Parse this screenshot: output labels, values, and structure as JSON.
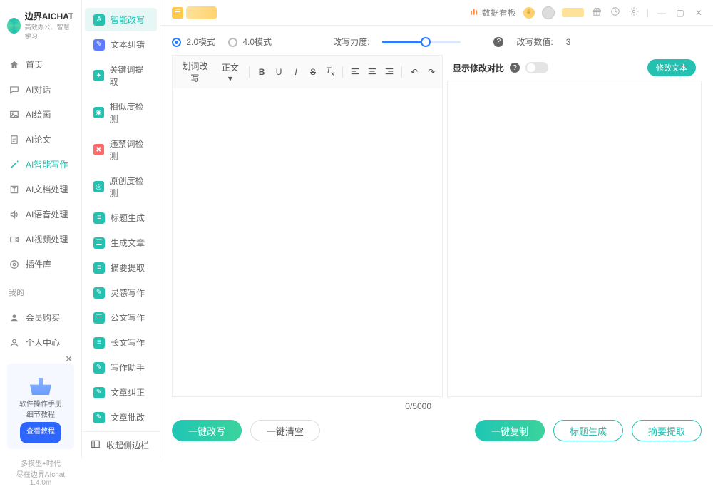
{
  "app": {
    "title": "边界AICHAT",
    "subtitle": "高效办公、智慧学习"
  },
  "nav": {
    "items": [
      {
        "label": "首页"
      },
      {
        "label": "AI对话"
      },
      {
        "label": "AI绘画"
      },
      {
        "label": "AI论文"
      },
      {
        "label": "AI智能写作"
      },
      {
        "label": "AI文档处理"
      },
      {
        "label": "AI语音处理"
      },
      {
        "label": "AI视频处理"
      },
      {
        "label": "插件库"
      }
    ],
    "mine_label": "我的",
    "mine": [
      {
        "label": "会员购买"
      },
      {
        "label": "个人中心"
      }
    ]
  },
  "promo": {
    "line1": "软件操作手册",
    "line2": "细节教程",
    "button": "查看教程"
  },
  "footer": {
    "line1": "多模型+时代",
    "line2": "尽在边界AIchat",
    "version": "1.4.0m"
  },
  "sub": {
    "items": [
      "智能改写",
      "文本纠错",
      "关键词提取",
      "相似度检测",
      "违禁词检测",
      "原创度检测",
      "标题生成",
      "生成文章",
      "摘要提取",
      "灵感写作",
      "公文写作",
      "长文写作",
      "写作助手",
      "文章纠正",
      "文章批改"
    ],
    "collapse": "收起侧边栏"
  },
  "breadcrumb": {
    "label": ""
  },
  "top": {
    "dashboard": "数据看板"
  },
  "options": {
    "mode20": "2.0模式",
    "mode40": "4.0模式",
    "strength_label": "改写力度:",
    "count_label": "改写数值:",
    "count_value": "3"
  },
  "toolbar": {
    "function_label": "划词改写",
    "format_label": "正文"
  },
  "right": {
    "compare_label": "显示修改对比",
    "modify_btn": "修改文本"
  },
  "counter": {
    "current": "0",
    "max": "5000"
  },
  "actions": {
    "rewrite": "一键改写",
    "clear": "一键清空",
    "copy": "一键复制",
    "gen_title": "标题生成",
    "extract": "摘要提取"
  },
  "colors": {
    "primary": "#24c0b0",
    "accent_blue": "#2d7dff",
    "warn": "#ff8a3d"
  },
  "sub_icon_colors": [
    "#24c0b0",
    "#5d7cff",
    "#24c0b0",
    "#24c0b0",
    "#ff6a6a",
    "#24c0b0",
    "#24c0b0",
    "#24c0b0",
    "#24c0b0",
    "#24c0b0",
    "#24c0b0",
    "#24c0b0",
    "#24c0b0",
    "#24c0b0",
    "#24c0b0"
  ]
}
